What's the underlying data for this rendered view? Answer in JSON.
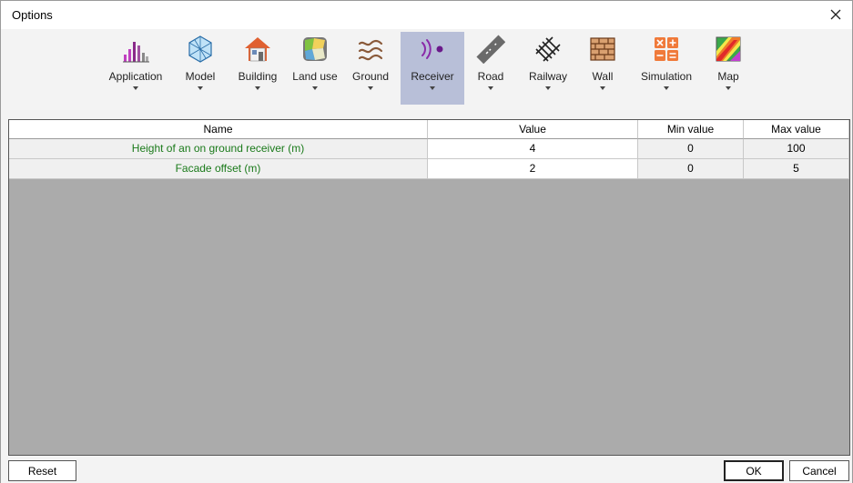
{
  "window": {
    "title": "Options"
  },
  "toolbar": {
    "items": [
      {
        "label": "Application",
        "icon": "application-icon"
      },
      {
        "label": "Model",
        "icon": "model-icon"
      },
      {
        "label": "Building",
        "icon": "building-icon"
      },
      {
        "label": "Land use",
        "icon": "land-use-icon"
      },
      {
        "label": "Ground",
        "icon": "ground-icon"
      },
      {
        "label": "Receiver",
        "icon": "receiver-icon",
        "selected": true
      },
      {
        "label": "Road",
        "icon": "road-icon"
      },
      {
        "label": "Railway",
        "icon": "railway-icon"
      },
      {
        "label": "Wall",
        "icon": "wall-icon"
      },
      {
        "label": "Simulation",
        "icon": "simulation-icon"
      },
      {
        "label": "Map",
        "icon": "map-icon"
      }
    ]
  },
  "table": {
    "columns": [
      "Name",
      "Value",
      "Min value",
      "Max value"
    ],
    "rows": [
      {
        "name": "Height of an on ground receiver (m)",
        "value": "4",
        "min": "0",
        "max": "100"
      },
      {
        "name": "Facade offset (m)",
        "value": "2",
        "min": "0",
        "max": "5"
      }
    ]
  },
  "buttons": {
    "reset": "Reset",
    "ok": "OK",
    "cancel": "Cancel"
  },
  "colors": {
    "selected_tab": "#b8bfd8",
    "name_text": "#1a7a1a",
    "empty_area": "#ababab"
  }
}
